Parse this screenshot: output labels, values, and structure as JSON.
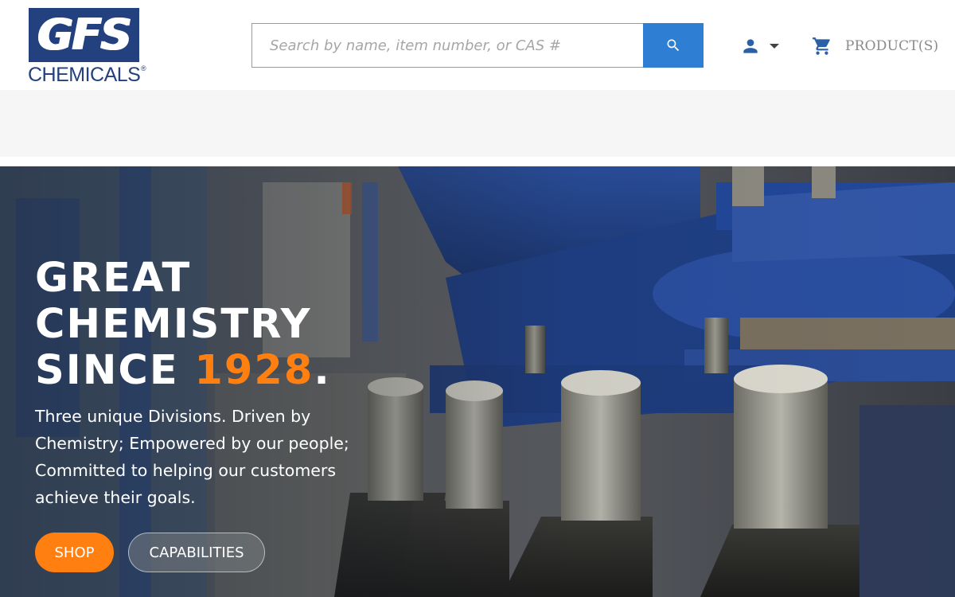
{
  "brand": {
    "logo_letters": "GFS",
    "logo_word": "CHEMICALS",
    "logo_registered": "®",
    "primary_color": "#23417e"
  },
  "search": {
    "placeholder": "Search by name, item number, or CAS #",
    "value": "",
    "button_icon": "search-icon",
    "button_color": "#2e7fd4"
  },
  "account": {
    "icon": "person-icon",
    "dropdown_icon": "caret-down-icon"
  },
  "cart": {
    "icon": "shopping-cart-icon",
    "label": "PRODUCT(S)"
  },
  "hero": {
    "headline_line1": "GREAT",
    "headline_line2": "CHEMISTRY",
    "headline_line3_prefix": "SINCE ",
    "headline_year": "1928",
    "headline_period": ".",
    "tagline": "Three unique Divisions. Driven by Chemistry; Empowered by our people; Committed to helping our customers achieve their goals.",
    "shop_label": "SHOP",
    "capabilities_label": "CAPABILITIES",
    "accent_color": "#ff7f11"
  }
}
